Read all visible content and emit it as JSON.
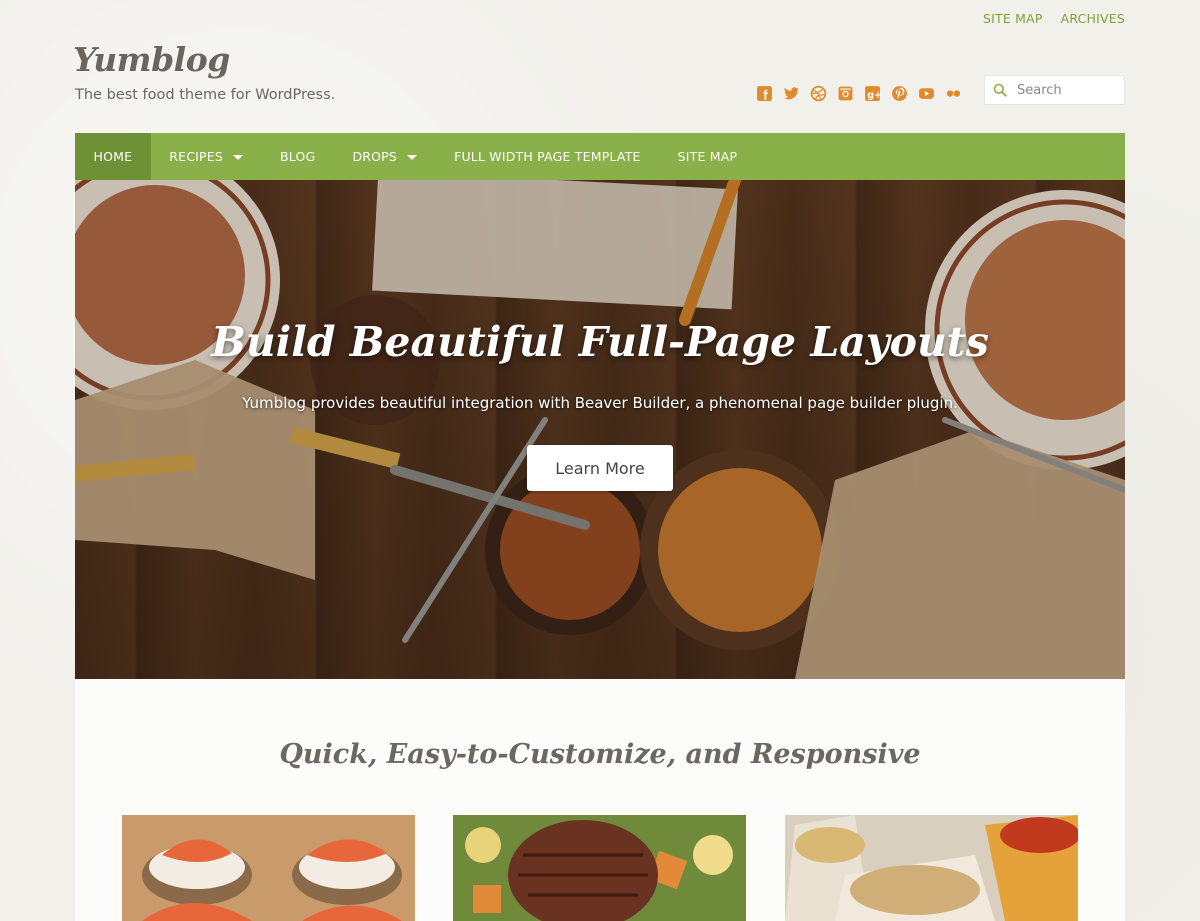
{
  "top_links": [
    "SITE MAP",
    "ARCHIVES"
  ],
  "site": {
    "logo": "Yumblog",
    "tagline": "The best food theme for WordPress."
  },
  "social_icons": [
    "facebook-icon",
    "twitter-icon",
    "dribbble-icon",
    "instagram-icon",
    "google-plus-icon",
    "pinterest-icon",
    "youtube-icon",
    "flickr-icon"
  ],
  "search": {
    "placeholder": "Search"
  },
  "nav": {
    "items": [
      {
        "label": "HOME",
        "active": true
      },
      {
        "label": "RECIPES",
        "dropdown": true
      },
      {
        "label": "BLOG"
      },
      {
        "label": "DROPS",
        "dropdown": true
      },
      {
        "label": "FULL WIDTH PAGE TEMPLATE"
      },
      {
        "label": "SITE MAP"
      }
    ]
  },
  "hero": {
    "title": "Build Beautiful Full-Page Layouts",
    "subtitle": "Yumblog provides beautiful integration with Beaver Builder, a phenomenal page builder plugin.",
    "button": "Learn More"
  },
  "section": {
    "title": "Quick, Easy-to-Customize, and Responsive"
  },
  "colors": {
    "accent": "#8ab04a",
    "accent_dark": "#6f9136",
    "link": "#7fa23a",
    "social": "#e08a2e"
  }
}
